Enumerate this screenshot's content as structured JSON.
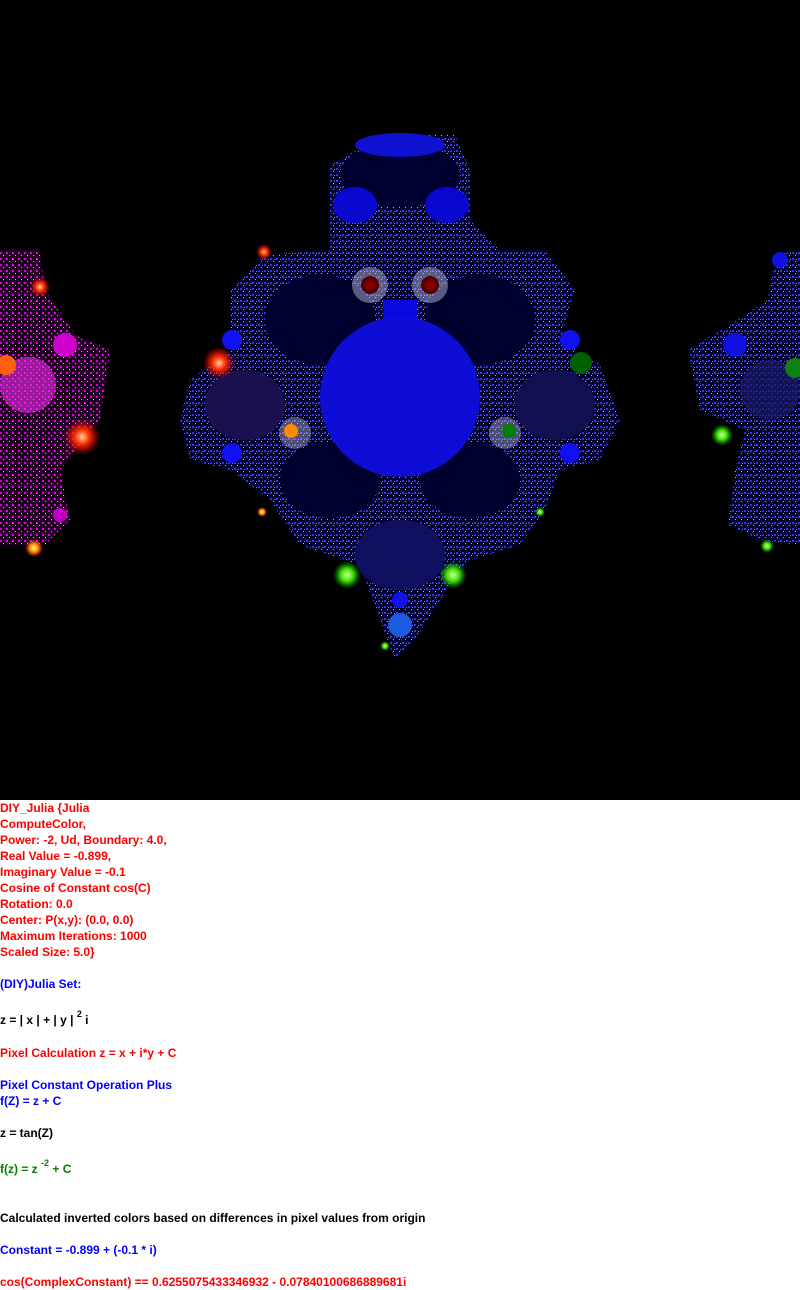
{
  "params": {
    "line1": "DIY_Julia {Julia",
    "line2": "ComputeColor,",
    "line3": "Power: -2, Ud, Boundary: 4.0,",
    "line4": "Real Value = -0.899,",
    "line5": "Imaginary Value = -0.1",
    "line6": "Cosine of Constant cos(C)",
    "line7": "Rotation: 0.0",
    "line8": "Center: P(x,y): (0.0, 0.0)",
    "line9": "Maximum Iterations: 1000",
    "line10": "Scaled Size: 5.0}"
  },
  "set_title": "(DIY)Julia Set:",
  "z_formula": {
    "base": "z = | x | + | y |",
    "exp": "2",
    "tail": " i"
  },
  "pixel_calc": "Pixel Calculation z = x + i*y + C",
  "constant_op": "Pixel Constant Operation Plus",
  "fz_plus": "f(Z) = z + C",
  "z_tan": "z = tan(Z)",
  "fz_power": {
    "base": "f(z) = z",
    "exp": "-2",
    "tail": " + C"
  },
  "colors_note": "Calculated inverted colors based on differences in pixel values from origin",
  "constant_line": "Constant = -0.899 + (-0.1 * i)",
  "cos_line": "cos(ComplexConstant) == 0.6255075433346932 - 0.07840100686889681i",
  "colors": {
    "background": "#000000",
    "fractal_main": "#0000e6",
    "red_text": "#ff0000",
    "blue_text": "#0000ff",
    "green_text": "#008000"
  }
}
